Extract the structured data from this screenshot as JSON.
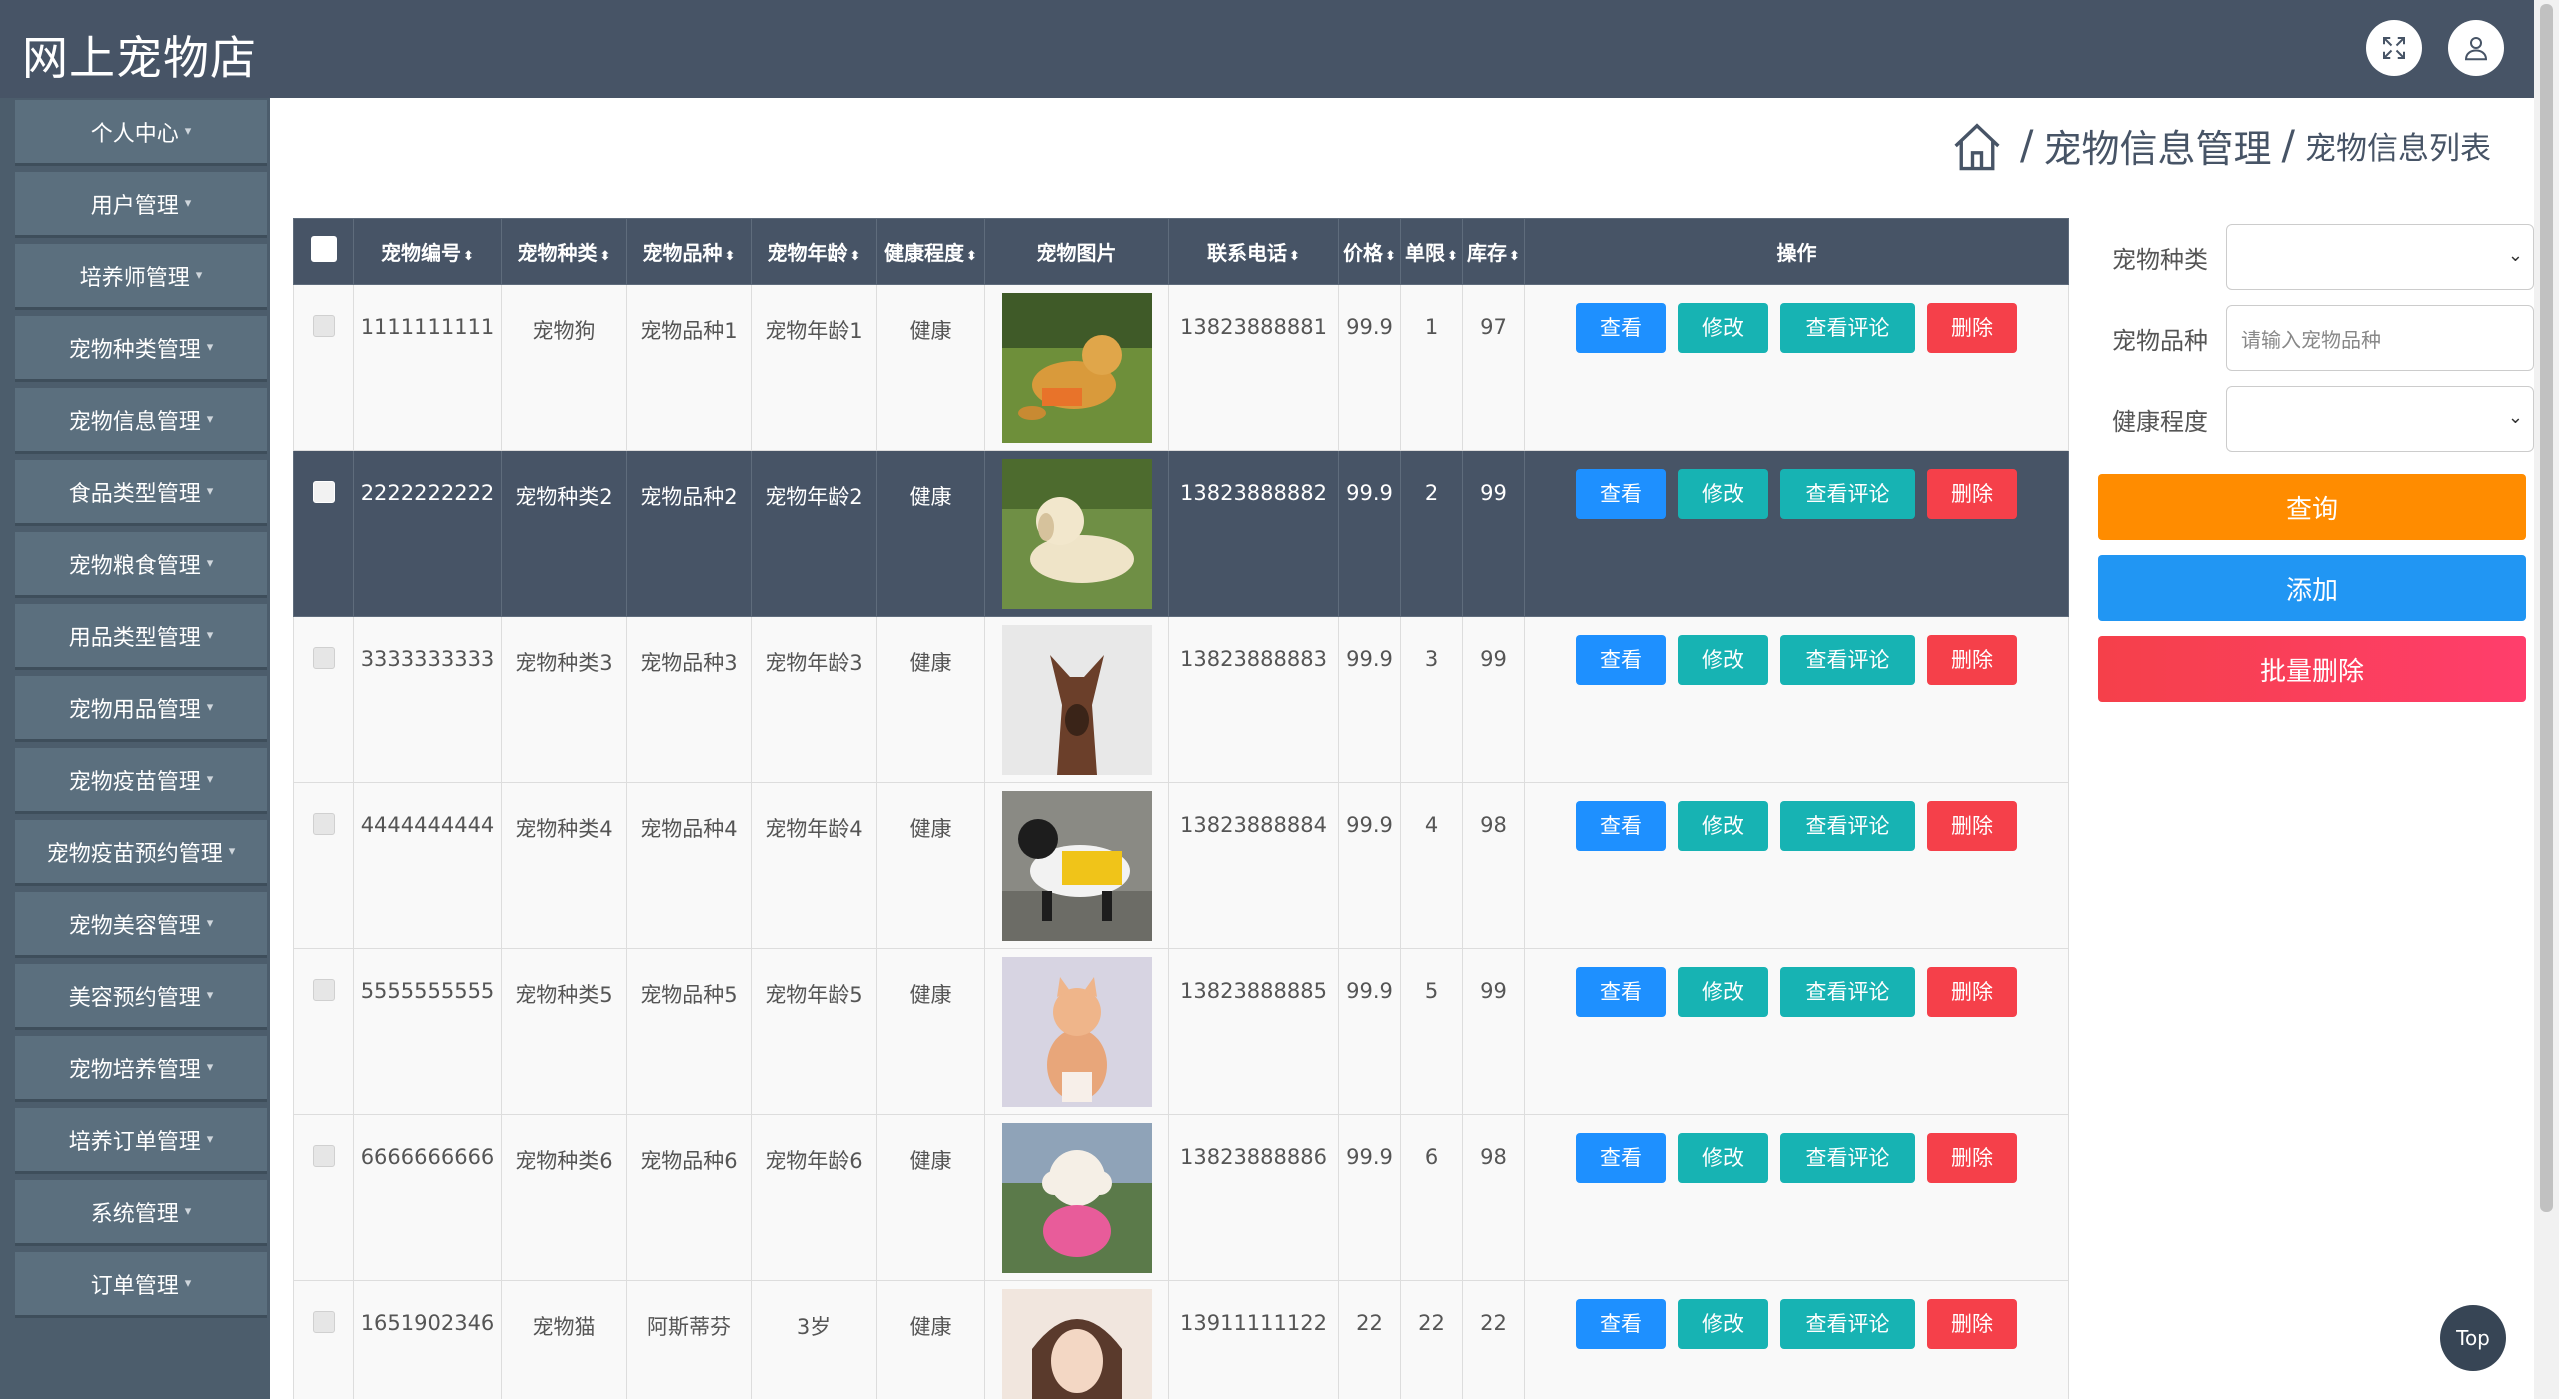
{
  "app": {
    "title": "网上宠物店"
  },
  "breadcrumb": {
    "sep": "/",
    "mid": "宠物信息管理",
    "last": "宠物信息列表"
  },
  "sidebar": {
    "items": [
      {
        "label": "个人中心"
      },
      {
        "label": "用户管理"
      },
      {
        "label": "培养师管理"
      },
      {
        "label": "宠物种类管理"
      },
      {
        "label": "宠物信息管理"
      },
      {
        "label": "食品类型管理"
      },
      {
        "label": "宠物粮食管理"
      },
      {
        "label": "用品类型管理"
      },
      {
        "label": "宠物用品管理"
      },
      {
        "label": "宠物疫苗管理"
      },
      {
        "label": "宠物疫苗预约管理"
      },
      {
        "label": "宠物美容管理"
      },
      {
        "label": "美容预约管理"
      },
      {
        "label": "宠物培养管理"
      },
      {
        "label": "培养订单管理"
      },
      {
        "label": "系统管理"
      },
      {
        "label": "订单管理"
      }
    ],
    "caret": "▾"
  },
  "table": {
    "sort_icon": "⬍",
    "headers": {
      "id": "宠物编号",
      "type": "宠物种类",
      "breed": "宠物品种",
      "age": "宠物年龄",
      "health": "健康程度",
      "image": "宠物图片",
      "phone": "联系电话",
      "price": "价格",
      "limit": "单限",
      "stock": "库存",
      "ops": "操作"
    },
    "rows": [
      {
        "id": "1111111111",
        "type": "宠物狗",
        "breed": "宠物品种1",
        "age": "宠物年龄1",
        "health": "健康",
        "phone": "13823888881",
        "price": "99.9",
        "limit": "1",
        "stock": "97"
      },
      {
        "id": "2222222222",
        "type": "宠物种类2",
        "breed": "宠物品种2",
        "age": "宠物年龄2",
        "health": "健康",
        "phone": "13823888882",
        "price": "99.9",
        "limit": "2",
        "stock": "99"
      },
      {
        "id": "3333333333",
        "type": "宠物种类3",
        "breed": "宠物品种3",
        "age": "宠物年龄3",
        "health": "健康",
        "phone": "13823888883",
        "price": "99.9",
        "limit": "3",
        "stock": "99"
      },
      {
        "id": "4444444444",
        "type": "宠物种类4",
        "breed": "宠物品种4",
        "age": "宠物年龄4",
        "health": "健康",
        "phone": "13823888884",
        "price": "99.9",
        "limit": "4",
        "stock": "98"
      },
      {
        "id": "5555555555",
        "type": "宠物种类5",
        "breed": "宠物品种5",
        "age": "宠物年龄5",
        "health": "健康",
        "phone": "13823888885",
        "price": "99.9",
        "limit": "5",
        "stock": "99"
      },
      {
        "id": "6666666666",
        "type": "宠物种类6",
        "breed": "宠物品种6",
        "age": "宠物年龄6",
        "health": "健康",
        "phone": "13823888886",
        "price": "99.9",
        "limit": "6",
        "stock": "98"
      },
      {
        "id": "1651902346",
        "type": "宠物猫",
        "breed": "阿斯蒂芬",
        "age": "3岁",
        "health": "健康",
        "phone": "13911111122",
        "price": "22",
        "limit": "22",
        "stock": "22"
      }
    ],
    "actions": {
      "view": "查看",
      "edit": "修改",
      "comment": "查看评论",
      "delete": "删除"
    }
  },
  "search": {
    "type_label": "宠物种类",
    "breed_label": "宠物品种",
    "breed_placeholder": "请输入宠物品种",
    "health_label": "健康程度",
    "dropdown_arrow": "⌄",
    "query": "查询",
    "add": "添加",
    "batch_delete": "批量删除"
  },
  "top_button": "Top",
  "colors": {
    "header_bg": "#475466",
    "sidebar_item_bg": "#5b6f7e",
    "view": "#1e90ff",
    "edit": "#17b3b3",
    "delete": "#f5404a",
    "query": "#ff8c00",
    "add": "#2196f3"
  }
}
